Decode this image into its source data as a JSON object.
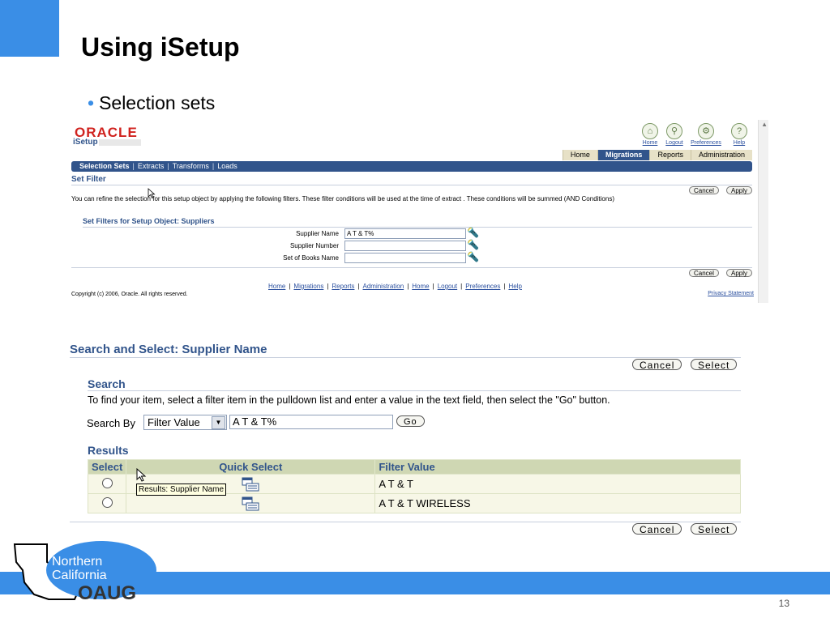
{
  "slide": {
    "title": "Using iSetup",
    "bullet": "Selection sets",
    "page_number": "13",
    "logo": {
      "line1": "Northern",
      "line2": "California",
      "line3": "OAUG"
    }
  },
  "isetup": {
    "brand": "ORACLE",
    "app_name": "iSetup",
    "global_links": [
      "Home",
      "Logout",
      "Preferences",
      "Help"
    ],
    "tabs": [
      "Home",
      "Migrations",
      "Reports",
      "Administration"
    ],
    "active_tab": "Migrations",
    "subnav": [
      "Selection Sets",
      "Extracts",
      "Transforms",
      "Loads"
    ],
    "section_title": "Set Filter",
    "description": "You can refine the selection for this setup object by applying the following filters. These filter conditions will be used at the time of extract . These conditions will be summed (AND Conditions)",
    "cancel_label": "Cancel",
    "apply_label": "Apply",
    "filters_title": "Set Filters for Setup Object: Suppliers",
    "fields": [
      {
        "label": "Supplier Name",
        "value": "A T & T%"
      },
      {
        "label": "Supplier Number",
        "value": ""
      },
      {
        "label": "Set of Books Name",
        "value": ""
      }
    ],
    "footer_links": [
      "Home",
      "Migrations",
      "Reports",
      "Administration",
      "Home",
      "Logout",
      "Preferences",
      "Help"
    ],
    "copyright": "Copyright (c) 2006, Oracle. All rights reserved.",
    "privacy": "Privacy Statement"
  },
  "search_select": {
    "title": "Search and Select: Supplier Name",
    "cancel_label": "Cancel",
    "select_label": "Select",
    "search_heading": "Search",
    "search_description": "To find your item, select a filter item in the pulldown list and enter a value in the text field, then select the \"Go\" button.",
    "search_by_label": "Search By",
    "search_by_value": "Filter Value",
    "search_value": "A T & T%",
    "go_label": "Go",
    "results_heading": "Results",
    "columns": [
      "Select",
      "Quick Select",
      "Filter Value"
    ],
    "rows": [
      {
        "filter_value": "A T & T"
      },
      {
        "filter_value": "A T & T WIRELESS"
      }
    ],
    "tooltip": "Results: Supplier Name"
  }
}
